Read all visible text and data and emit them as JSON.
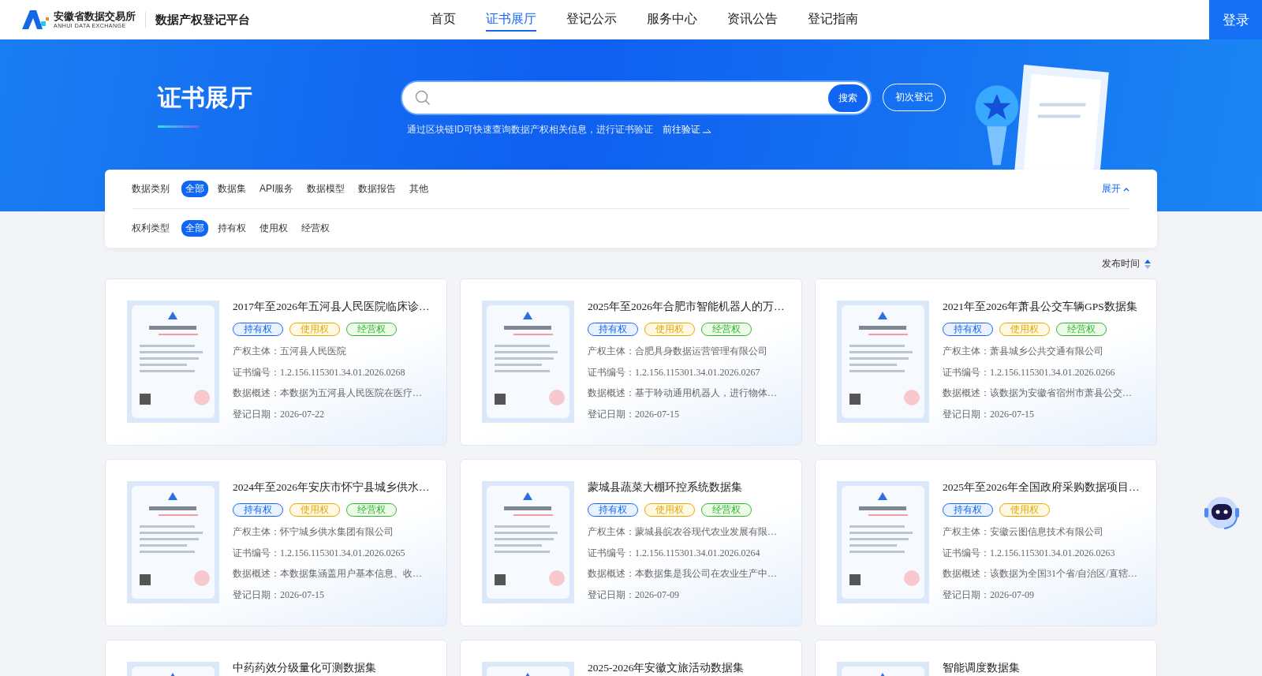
{
  "header": {
    "logo_name": "安徽省数据交易所",
    "logo_sub": "ANHUI DATA EXCHANGE",
    "platform": "数据产权登记平台",
    "nav": [
      {
        "label": "首页",
        "selected": false
      },
      {
        "label": "证书展厅",
        "selected": true
      },
      {
        "label": "登记公示",
        "selected": false
      },
      {
        "label": "服务中心",
        "selected": false
      },
      {
        "label": "资讯公告",
        "selected": false
      },
      {
        "label": "登记指南",
        "selected": false
      }
    ],
    "login": "登录"
  },
  "banner": {
    "title": "证书展厅",
    "search_button": "搜索",
    "register_button": "初次登记",
    "hint": "通过区块链ID可快速查询数据产权相关信息，进行证书验证",
    "verify_link": "前往验证"
  },
  "filters": [
    {
      "label": "数据类别",
      "options": [
        {
          "label": "全部",
          "selected": true
        },
        {
          "label": "数据集",
          "selected": false
        },
        {
          "label": "API服务",
          "selected": false
        },
        {
          "label": "数据模型",
          "selected": false
        },
        {
          "label": "数据报告",
          "selected": false
        },
        {
          "label": "其他",
          "selected": false
        }
      ],
      "toggle": "展开"
    },
    {
      "label": "权利类型",
      "options": [
        {
          "label": "全部",
          "selected": true
        },
        {
          "label": "持有权",
          "selected": false
        },
        {
          "label": "使用权",
          "selected": false
        },
        {
          "label": "经营权",
          "selected": false
        }
      ]
    }
  ],
  "sort": {
    "label": "发布时间"
  },
  "cards": [
    {
      "title": "2017年至2026年五河县人民医院临床诊…",
      "tags": [
        {
          "kind": "hold",
          "label": "持有权"
        },
        {
          "kind": "use",
          "label": "使用权"
        },
        {
          "kind": "operate",
          "label": "经营权"
        }
      ],
      "owner": "产权主体：五河县人民医院",
      "number": "证书编号：1.2.156.115301.34.01.2026.0268",
      "summary": "数据概述：本数据为五河县人民医院在医疗…",
      "date": "登记日期：2026-07-22"
    },
    {
      "title": "2025年至2026年合肥市智能机器人的万…",
      "tags": [
        {
          "kind": "hold",
          "label": "持有权"
        },
        {
          "kind": "use",
          "label": "使用权"
        },
        {
          "kind": "operate",
          "label": "经营权"
        }
      ],
      "owner": "产权主体：合肥具身数据运营管理有限公司",
      "number": "证书编号：1.2.156.115301.34.01.2026.0267",
      "summary": "数据概述：基于聆动通用机器人，进行物体…",
      "date": "登记日期：2026-07-15"
    },
    {
      "title": "2021年至2026年萧县公交车辆GPS数据集",
      "tags": [
        {
          "kind": "hold",
          "label": "持有权"
        },
        {
          "kind": "use",
          "label": "使用权"
        },
        {
          "kind": "operate",
          "label": "经营权"
        }
      ],
      "owner": "产权主体：萧县城乡公共交通有限公司",
      "number": "证书编号：1.2.156.115301.34.01.2026.0266",
      "summary": "数据概述：该数据为安徽省宿州市萧县公交…",
      "date": "登记日期：2026-07-15"
    },
    {
      "title": "2024年至2026年安庆市怀宁县城乡供水…",
      "tags": [
        {
          "kind": "hold",
          "label": "持有权"
        },
        {
          "kind": "use",
          "label": "使用权"
        },
        {
          "kind": "operate",
          "label": "经营权"
        }
      ],
      "owner": "产权主体：怀宁城乡供水集团有限公司",
      "number": "证书编号：1.2.156.115301.34.01.2026.0265",
      "summary": "数据概述：本数据集涵盖用户基本信息、收…",
      "date": "登记日期：2026-07-15"
    },
    {
      "title": "蒙城县蔬菜大棚环控系统数据集",
      "tags": [
        {
          "kind": "hold",
          "label": "持有权"
        },
        {
          "kind": "use",
          "label": "使用权"
        },
        {
          "kind": "operate",
          "label": "经营权"
        }
      ],
      "owner": "产权主体：蒙城县皖农谷现代农业发展有限…",
      "number": "证书编号：1.2.156.115301.34.01.2026.0264",
      "summary": "数据概述：本数据集是我公司在农业生产中…",
      "date": "登记日期：2026-07-09"
    },
    {
      "title": "2025年至2026年全国政府采购数据项目…",
      "tags": [
        {
          "kind": "hold",
          "label": "持有权"
        },
        {
          "kind": "use",
          "label": "使用权"
        }
      ],
      "owner": "产权主体：安徽云图信息技术有限公司",
      "number": "证书编号：1.2.156.115301.34.01.2026.0263",
      "summary": "数据概述：该数据为全国31个省/自治区/直辖…",
      "date": "登记日期：2026-07-09"
    },
    {
      "title": "中药药效分级量化可测数据集"
    },
    {
      "title": "2025-2026年安徽文旅活动数据集"
    },
    {
      "title": "智能调度数据集"
    }
  ]
}
